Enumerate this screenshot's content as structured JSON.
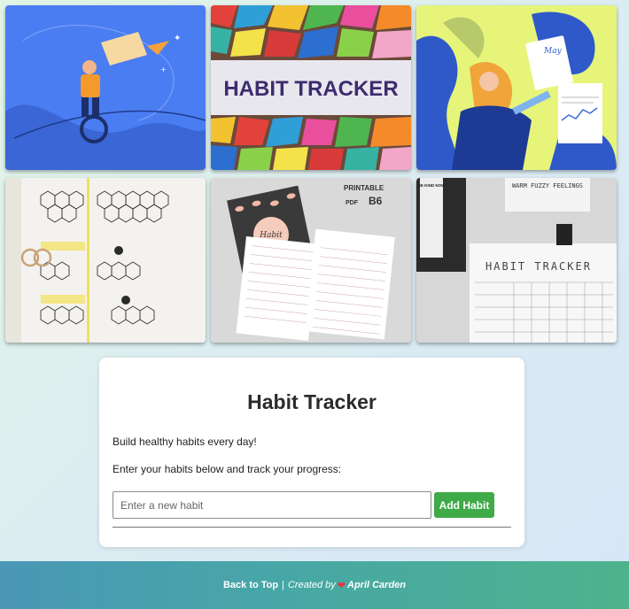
{
  "gallery": {
    "tiles": [
      {
        "name": "tile-unicycle-illustration",
        "banner": ""
      },
      {
        "name": "tile-mosaic-habit-tracker",
        "banner": "HABIT TRACKER"
      },
      {
        "name": "tile-woman-planner-illustration",
        "banner": ""
      },
      {
        "name": "tile-hexagon-journal",
        "banner": ""
      },
      {
        "name": "tile-printable-b6",
        "banner": "PRINTABLE",
        "sub": "B6",
        "small": "PDF",
        "cover": "Habit"
      },
      {
        "name": "tile-photo-habit-tracker",
        "banner": "HABIT TRACKER",
        "small": "WARM FUZZY FEELINGS",
        "sign": "BE KIND NOW"
      }
    ]
  },
  "card": {
    "title": "Habit Tracker",
    "tagline": "Build healthy habits every day!",
    "instruction": "Enter your habits below and track your progress:",
    "input_placeholder": "Enter a new habit",
    "input_value": "",
    "add_button": "Add Habit"
  },
  "footer": {
    "back_to_top": "Back to Top",
    "separator": "|",
    "created_by": "Created by",
    "heart_icon": "heart-icon",
    "author": "April Carden"
  },
  "colors": {
    "button": "#3faa48",
    "footer_start": "#4a97b6",
    "footer_end": "#4db38c",
    "heart": "#e6343f"
  }
}
